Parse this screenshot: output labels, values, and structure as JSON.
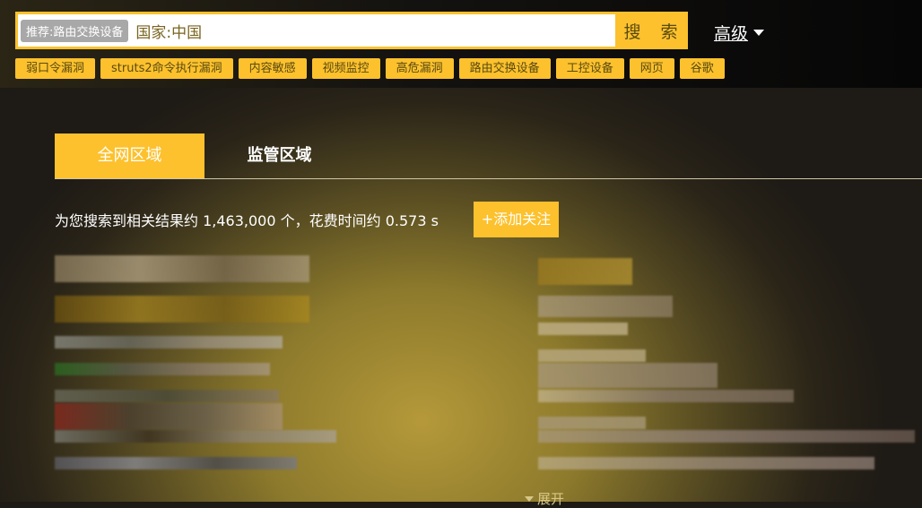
{
  "search": {
    "recommend_badge": "推荐:路由交换设备",
    "query": "国家:中国",
    "button": "搜 索",
    "advanced": "高级"
  },
  "tags": [
    "弱口令漏洞",
    "struts2命令执行漏洞",
    "内容敏感",
    "视频监控",
    "高危漏洞",
    "路由交换设备",
    "工控设备",
    "网页",
    "谷歌"
  ],
  "tabs": [
    {
      "label": "全网区域",
      "active": true
    },
    {
      "label": "监管区域",
      "active": false
    }
  ],
  "results": {
    "summary": "为您搜索到相关结果约 1,463,000 个，花费时间约 0.573 s",
    "follow_button": "+添加关注",
    "expand": "展开"
  },
  "colors": {
    "accent": "#fcc12d"
  }
}
